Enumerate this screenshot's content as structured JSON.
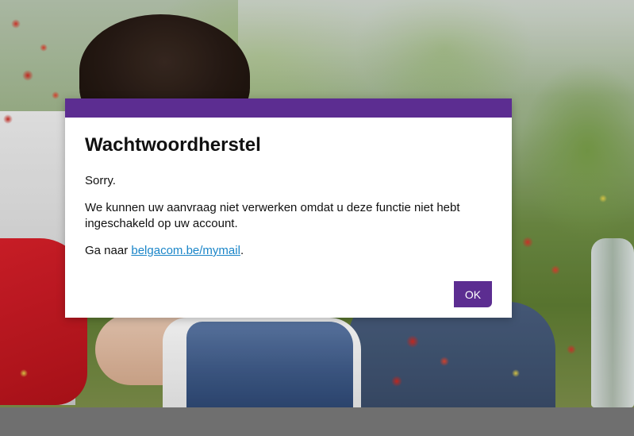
{
  "dialog": {
    "title": "Wachtwoordherstel",
    "line_sorry": "Sorry.",
    "message": "We kunnen uw aanvraag niet verwerken omdat u deze functie niet hebt ingeschakeld op uw account.",
    "goto_prefix": "Ga naar ",
    "link_text": "belgacom.be/mymail",
    "goto_suffix": ".",
    "ok_label": "OK"
  },
  "colors": {
    "accent": "#5c2d91",
    "link": "#1a85c8"
  }
}
